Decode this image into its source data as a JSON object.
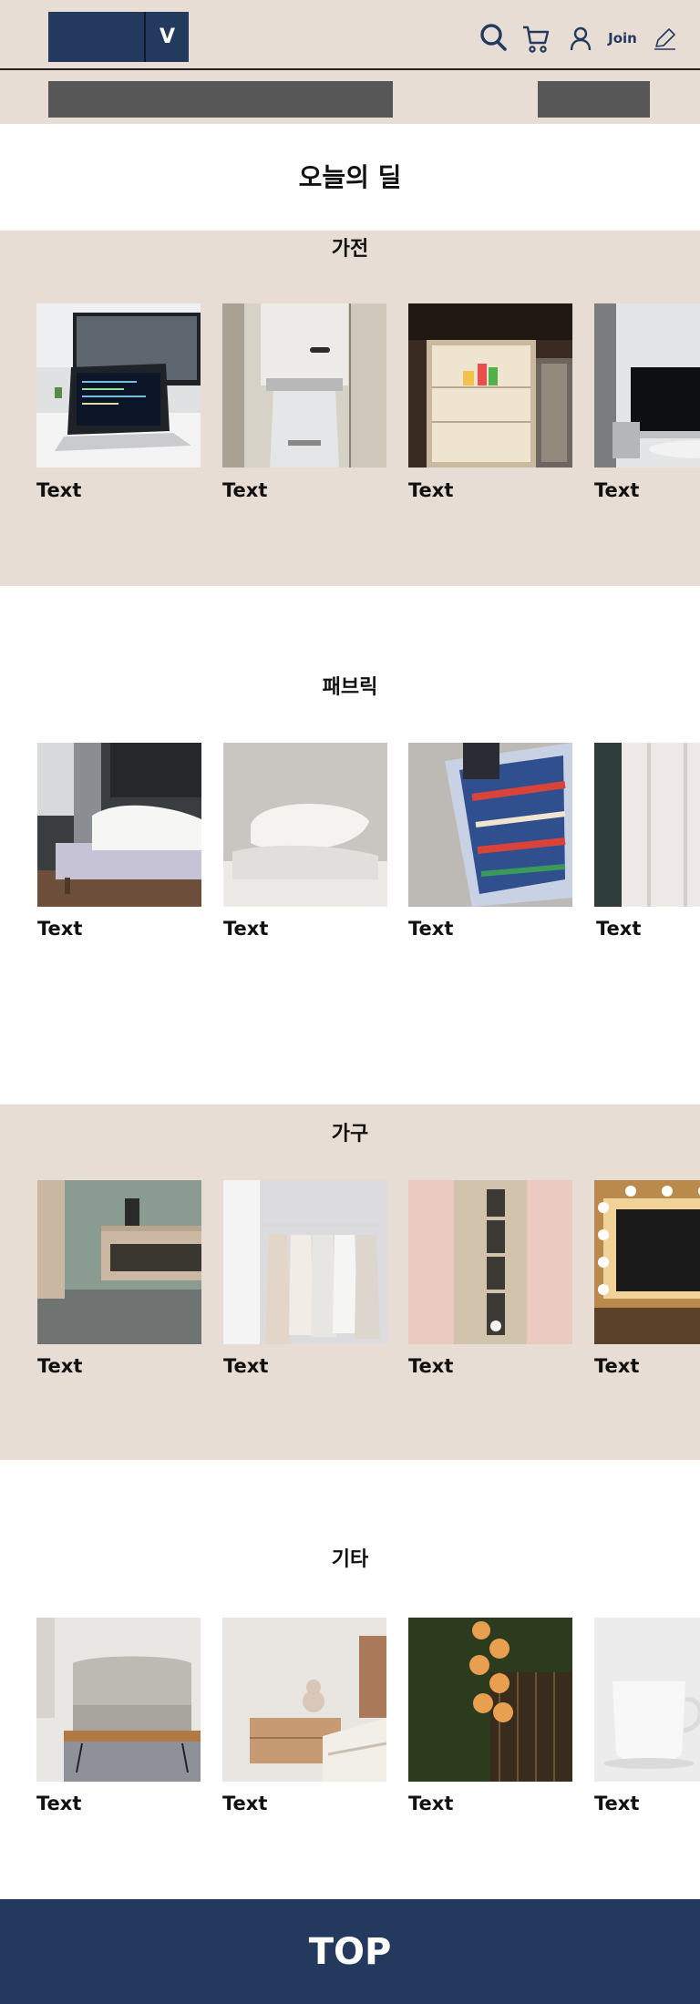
{
  "header": {
    "logo_letter": "V",
    "join_label": "Join",
    "icons": [
      "search-icon",
      "cart-icon",
      "user-icon",
      "pencil-icon"
    ]
  },
  "page_title": "오늘의 딜",
  "sections": [
    {
      "title": "가전",
      "items": [
        {
          "label": "Text",
          "image": "laptop"
        },
        {
          "label": "Text",
          "image": "soda-maker"
        },
        {
          "label": "Text",
          "image": "open-fridge"
        },
        {
          "label": "Text",
          "image": "tv-living-room"
        }
      ]
    },
    {
      "title": "패브릭",
      "items": [
        {
          "label": "Text",
          "image": "bed"
        },
        {
          "label": "Text",
          "image": "pillows"
        },
        {
          "label": "Text",
          "image": "patterned-rug"
        },
        {
          "label": "Text",
          "image": "sheer-curtain"
        }
      ]
    },
    {
      "title": "가구",
      "items": [
        {
          "label": "Text",
          "image": "bathroom-shelf"
        },
        {
          "label": "Text",
          "image": "clothing-rack"
        },
        {
          "label": "Text",
          "image": "wood-cabinet"
        },
        {
          "label": "Text",
          "image": "vanity-mirror"
        }
      ]
    },
    {
      "title": "기타",
      "items": [
        {
          "label": "Text",
          "image": "sofa-coffee-table"
        },
        {
          "label": "Text",
          "image": "bedside-table"
        },
        {
          "label": "Text",
          "image": "pendant-lights"
        },
        {
          "label": "Text",
          "image": "white-mug"
        }
      ]
    }
  ],
  "footer": {
    "top_label": "TOP"
  },
  "colors": {
    "navy": "#233a5e",
    "beige": "#e8ddd4",
    "placeholder_gray": "#575757"
  }
}
